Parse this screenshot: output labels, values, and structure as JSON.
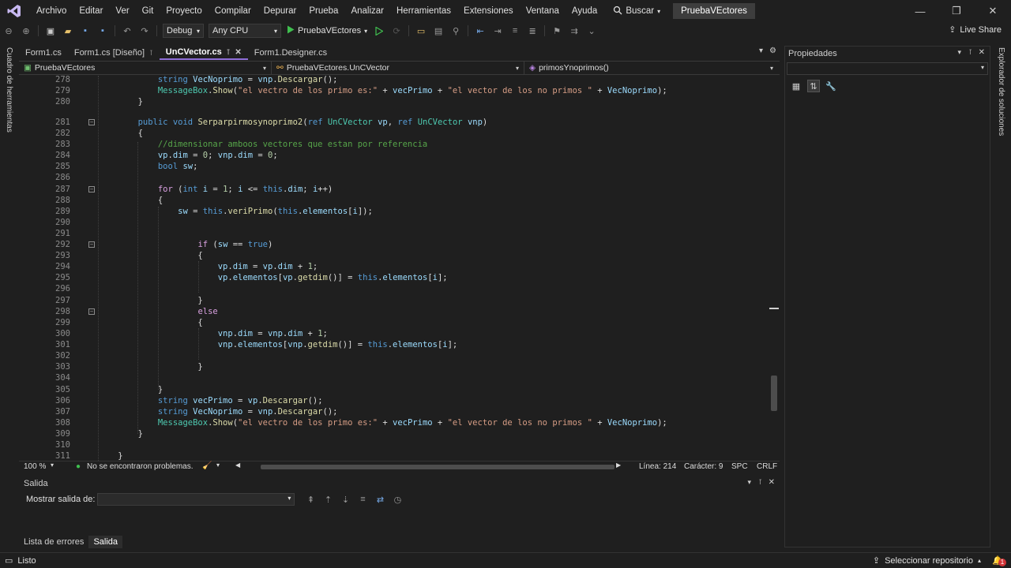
{
  "menubar": {
    "items": [
      "Archivo",
      "Editar",
      "Ver",
      "Git",
      "Proyecto",
      "Compilar",
      "Depurar",
      "Prueba",
      "Analizar",
      "Herramientas",
      "Extensiones",
      "Ventana",
      "Ayuda"
    ],
    "search_label": "Buscar",
    "project_badge": "PruebaVEctores"
  },
  "toolbar": {
    "config": "Debug",
    "platform": "Any CPU",
    "run_target": "PruebaVEctores",
    "live_share": "Live Share"
  },
  "side_tabs": {
    "left": "Cuadro de herramientas",
    "right": "Explorador de soluciones"
  },
  "tabs": [
    {
      "label": "Form1.cs",
      "active": false,
      "pinned": false
    },
    {
      "label": "Form1.cs [Diseño]",
      "active": false,
      "pinned": true
    },
    {
      "label": "UnCVector.cs",
      "active": true,
      "pinned": true
    },
    {
      "label": "Form1.Designer.cs",
      "active": false,
      "pinned": false
    }
  ],
  "navbar": {
    "project": "PruebaVEctores",
    "class": "PruebaVEctores.UnCVector",
    "member": "primosYnoprimos()"
  },
  "code_lines": [
    {
      "n": "278",
      "html": "            <span class=\"kw\">string</span> <span class=\"var\">VecNoprimo</span> = <span class=\"var\">vnp</span>.<span class=\"fn\">Descargar</span>();"
    },
    {
      "n": "279",
      "html": "            <span class=\"ty\">MessageBox</span>.<span class=\"fn\">Show</span>(<span class=\"str\">\"el vectro de los primo es:\"</span> + <span class=\"var\">vecPrimo</span> + <span class=\"str\">\"el vector de los no primos \"</span> + <span class=\"var\">VecNoprimo</span>);"
    },
    {
      "n": "280",
      "html": "        }"
    },
    {
      "n": "",
      "html": ""
    },
    {
      "n": "281",
      "html": "        <span class=\"kw\">public</span> <span class=\"kw\">void</span> <span class=\"fn\">Serparpirmosynoprimo2</span>(<span class=\"kw\">ref</span> <span class=\"ty\">UnCVector</span> <span class=\"var\">vp</span>, <span class=\"kw\">ref</span> <span class=\"ty\">UnCVector</span> <span class=\"var\">vnp</span>)",
      "fold": true
    },
    {
      "n": "282",
      "html": "        {"
    },
    {
      "n": "283",
      "html": "            <span class=\"cm\">//dimensionar amboos vectores que estan por referencia</span>"
    },
    {
      "n": "284",
      "html": "            <span class=\"var\">vp</span>.<span class=\"var\">dim</span> = <span class=\"num\">0</span>; <span class=\"var\">vnp</span>.<span class=\"var\">dim</span> = <span class=\"num\">0</span>;"
    },
    {
      "n": "285",
      "html": "            <span class=\"kw\">bool</span> <span class=\"var\">sw</span>;"
    },
    {
      "n": "286",
      "html": ""
    },
    {
      "n": "287",
      "html": "            <span class=\"kw2\">for</span> (<span class=\"kw\">int</span> <span class=\"var\">i</span> = <span class=\"num\">1</span>; <span class=\"var\">i</span> &lt;= <span class=\"kw\">this</span>.<span class=\"var\">dim</span>; <span class=\"var\">i</span>++)",
      "fold": true
    },
    {
      "n": "288",
      "html": "            {"
    },
    {
      "n": "289",
      "html": "                <span class=\"var\">sw</span> = <span class=\"kw\">this</span>.<span class=\"fn\">veriPrimo</span>(<span class=\"kw\">this</span>.<span class=\"var\">elementos</span>[<span class=\"var\">i</span>]);"
    },
    {
      "n": "290",
      "html": ""
    },
    {
      "n": "291",
      "html": ""
    },
    {
      "n": "292",
      "html": "                    <span class=\"kw2\">if</span> (<span class=\"var\">sw</span> == <span class=\"kw\">true</span>)",
      "fold": true
    },
    {
      "n": "293",
      "html": "                    {"
    },
    {
      "n": "294",
      "html": "                        <span class=\"var\">vp</span>.<span class=\"var\">dim</span> = <span class=\"var\">vp</span>.<span class=\"var\">dim</span> + <span class=\"num\">1</span>;"
    },
    {
      "n": "295",
      "html": "                        <span class=\"var\">vp</span>.<span class=\"var\">elementos</span>[<span class=\"var\">vp</span>.<span class=\"fn\">getdim</span>()] = <span class=\"kw\">this</span>.<span class=\"var\">elementos</span>[<span class=\"var\">i</span>];"
    },
    {
      "n": "296",
      "html": ""
    },
    {
      "n": "297",
      "html": "                    }"
    },
    {
      "n": "298",
      "html": "                    <span class=\"kw2\">else</span>",
      "fold": true
    },
    {
      "n": "299",
      "html": "                    {"
    },
    {
      "n": "300",
      "html": "                        <span class=\"var\">vnp</span>.<span class=\"var\">dim</span> = <span class=\"var\">vnp</span>.<span class=\"var\">dim</span> + <span class=\"num\">1</span>;"
    },
    {
      "n": "301",
      "html": "                        <span class=\"var\">vnp</span>.<span class=\"var\">elementos</span>[<span class=\"var\">vnp</span>.<span class=\"fn\">getdim</span>()] = <span class=\"kw\">this</span>.<span class=\"var\">elementos</span>[<span class=\"var\">i</span>];"
    },
    {
      "n": "302",
      "html": ""
    },
    {
      "n": "303",
      "html": "                    }"
    },
    {
      "n": "304",
      "html": ""
    },
    {
      "n": "305",
      "html": "            }"
    },
    {
      "n": "306",
      "html": "            <span class=\"kw\">string</span> <span class=\"var\">vecPrimo</span> = <span class=\"var\">vp</span>.<span class=\"fn\">Descargar</span>();"
    },
    {
      "n": "307",
      "html": "            <span class=\"kw\">string</span> <span class=\"var\">VecNoprimo</span> = <span class=\"var\">vnp</span>.<span class=\"fn\">Descargar</span>();"
    },
    {
      "n": "308",
      "html": "            <span class=\"ty\">MessageBox</span>.<span class=\"fn\">Show</span>(<span class=\"str\">\"el vectro de los primo es:\"</span> + <span class=\"var\">vecPrimo</span> + <span class=\"str\">\"el vector de los no primos \"</span> + <span class=\"var\">VecNoprimo</span>);"
    },
    {
      "n": "309",
      "html": "        }"
    },
    {
      "n": "310",
      "html": ""
    },
    {
      "n": "311",
      "html": "    }"
    }
  ],
  "editor_status": {
    "zoom": "100 %",
    "problems": "No se encontraron problemas.",
    "line": "Línea: 214",
    "char": "Carácter: 9",
    "spc": "SPC",
    "eol": "CRLF"
  },
  "output": {
    "title": "Salida",
    "show_from": "Mostrar salida de:"
  },
  "bottom_tabs": [
    "Lista de errores",
    "Salida"
  ],
  "properties": {
    "title": "Propiedades"
  },
  "statusbar": {
    "status": "Listo",
    "repo": "Seleccionar repositorio",
    "notifications": "1"
  },
  "colors": {
    "accent": "#8f6fd8",
    "run_green": "#3fbf4f",
    "notification_red": "#d13438"
  }
}
